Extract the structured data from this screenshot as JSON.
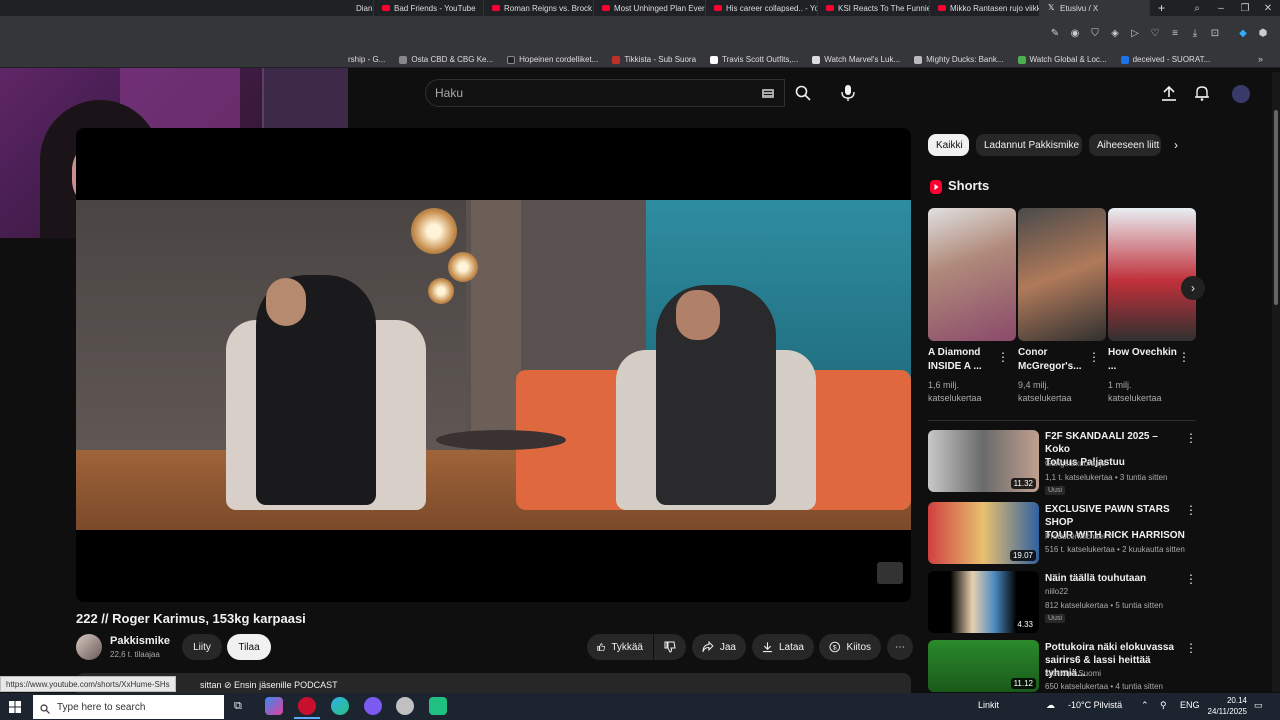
{
  "browser": {
    "tabs": [
      {
        "label": "Dian",
        "type": "yt"
      },
      {
        "label": "Bad Friends - YouTube",
        "type": "yt"
      },
      {
        "label": "Roman Reigns vs. Brock L",
        "type": "yt"
      },
      {
        "label": "Most Unhinged Plan Ever",
        "type": "yt"
      },
      {
        "label": "His career collapsed.. - Yo",
        "type": "yt"
      },
      {
        "label": "KSI Reacts To The Funnies",
        "type": "yt"
      },
      {
        "label": "Mikko Rantasen rujo viikk",
        "type": "yt"
      },
      {
        "label": "Etusivu / X",
        "type": "x"
      }
    ],
    "bookmarks": [
      "rship - G...",
      "Osta CBD & CBG Ke...",
      "Hopeinen cordelliket...",
      "Tikkista - Sub Suora",
      "Travis Scott Outfits,...",
      "Watch Marvel's Luk...",
      "Mighty Ducks: Bank...",
      "Watch Global & Loc...",
      "deceived - SUORAT..."
    ]
  },
  "header": {
    "search_placeholder": "Haku"
  },
  "video": {
    "title": "222 // Roger Karimus, 153kg karpaasi",
    "channel": "Pakkismike",
    "subscribers": "22,6 t. tilaajaa",
    "join_label": "Liity",
    "subscribe_label": "Tilaa",
    "like_label": "Tykkää",
    "share_label": "Jaa",
    "download_label": "Lataa",
    "thanks_label": "Kiitos",
    "description_snippet": "sittan  ⊘ Ensin jäsenille  PODCAST"
  },
  "status_url": "https://www.youtube.com/shorts/XxHume-SHs",
  "chips": [
    "Kaikki",
    "Ladannut Pakkismike",
    "Aiheeseen liitt"
  ],
  "shorts": {
    "heading": "Shorts",
    "items": [
      {
        "title": "A Diamond INSIDE A ...",
        "views": "1,6 milj.",
        "views2": "katselukertaa"
      },
      {
        "title": "Conor McGregor's...",
        "views": "9,4 milj.",
        "views2": "katselukertaa"
      },
      {
        "title": "How Ovechkin ...",
        "views": "1 milj.",
        "views2": "katselukertaa"
      }
    ]
  },
  "related": [
    {
      "title1": "F2F SKANDAALI 2025 – Koko",
      "title2": "Totuus Paljastuu",
      "channel": "Gangstakuoraaja",
      "meta": "1,1 t. katselukertaa • 3 tuntia sitten",
      "badge": "Uusi",
      "duration": "11.32"
    },
    {
      "title1": "EXCLUSIVE PAWN STARS SHOP",
      "title2": "TOUR WITH RICK HARRISON",
      "channel": "ProducerMichael ✓",
      "meta": "516 t. katselukertaa • 2 kuukautta sitten",
      "badge": "",
      "duration": "19.07"
    },
    {
      "title1": "Näin täällä touhutaan",
      "title2": "",
      "channel": "niilo22",
      "meta": "812 katselukertaa • 5 tuntia sitten",
      "badge": "Uusi",
      "duration": "4.33"
    },
    {
      "title1": "Pottukoira näki elokuvassa",
      "title2": "sairirs6 & lassi heittää tyhmiä...",
      "channel": "Kickklipit Suomi",
      "meta": "650 katselukertaa • 4 tuntia sitten",
      "badge": "",
      "duration": "11.12"
    }
  ],
  "taskbar": {
    "search_placeholder": "Type here to search",
    "links": "Linkit",
    "weather": "-10°C  Pilvistä",
    "lang": "ENG",
    "time": "20.14",
    "date": "24/11/2025"
  },
  "colors": {
    "yt_red": "#ff0033",
    "background": "#0f0f0f",
    "chip_active": "#f1f1f1"
  }
}
